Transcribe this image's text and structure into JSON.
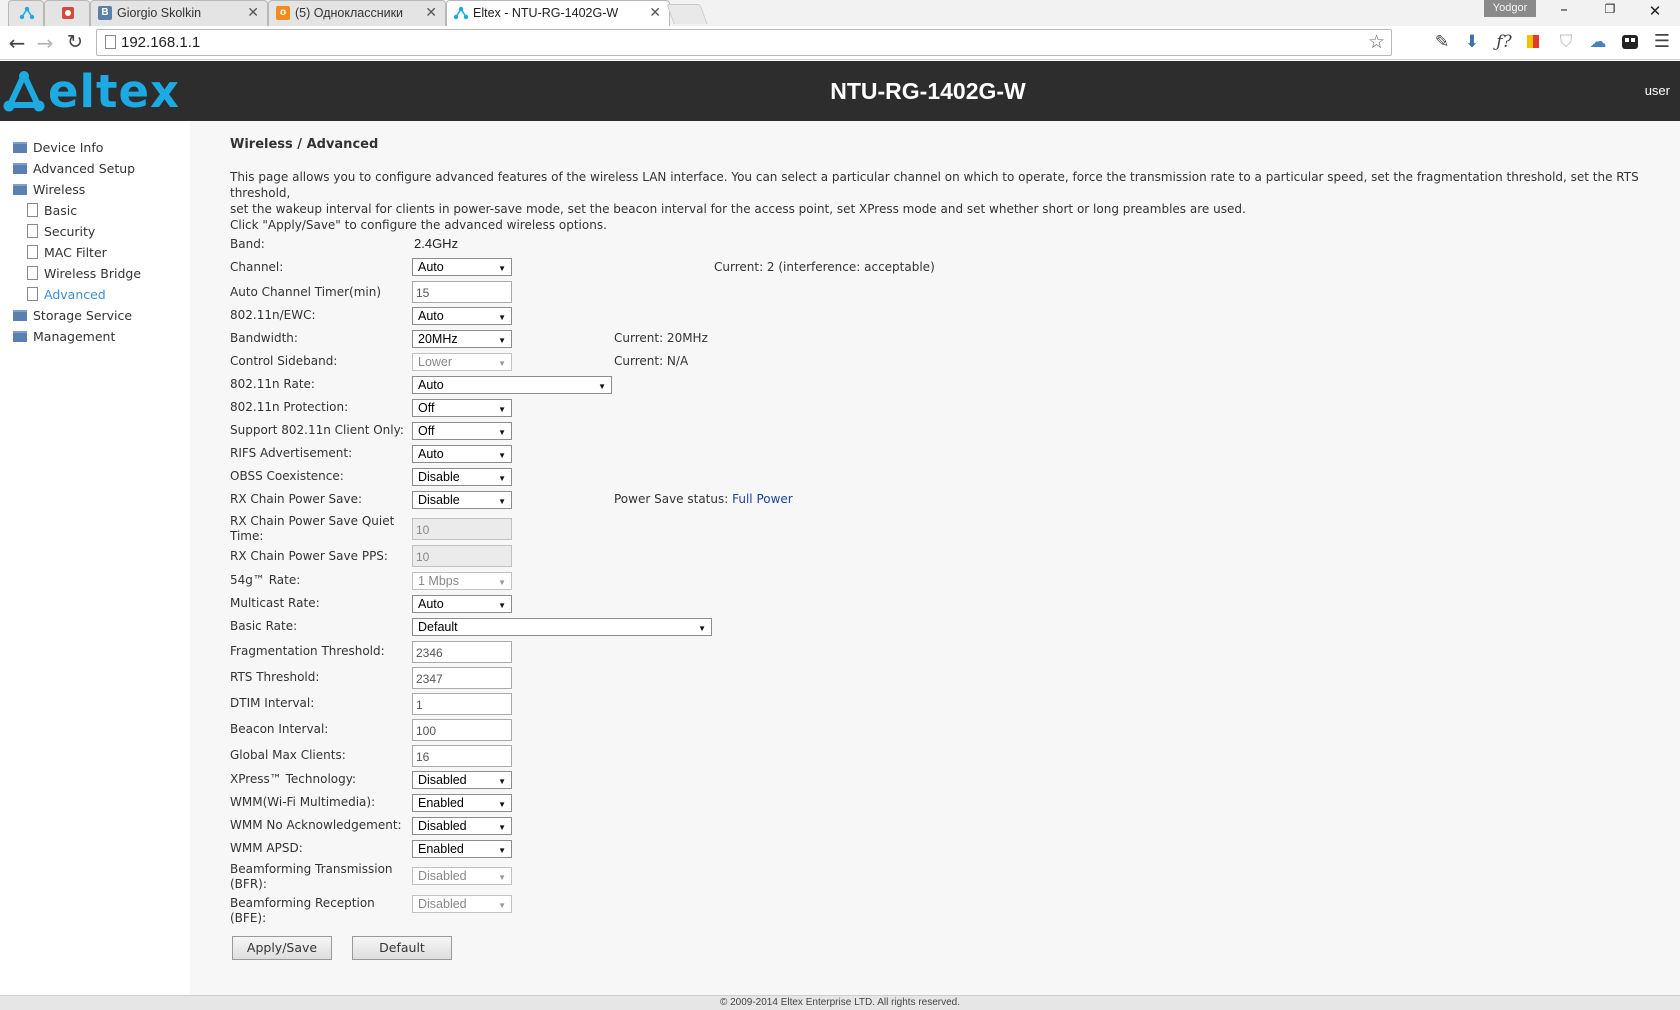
{
  "browser": {
    "tabs": [
      {
        "title": "Giorgio Skolkin",
        "icon": "vk-icon",
        "color": "#5b7fa6"
      },
      {
        "title": "(5) Одноклассники",
        "icon": "ok-icon",
        "color": "#f28a1e"
      },
      {
        "title": "Eltex - NTU-RG-1402G-W",
        "icon": "eltex-icon",
        "color": "#1da9e1"
      }
    ],
    "profile": "Yodgor",
    "url": "192.168.1.1",
    "tab_close_glyph": "✕"
  },
  "header": {
    "logo_text": "eltex",
    "model": "NTU-RG-1402G-W",
    "user": "user"
  },
  "sidebar": {
    "items": [
      {
        "label": "Device Info",
        "type": "folder"
      },
      {
        "label": "Advanced Setup",
        "type": "folder"
      },
      {
        "label": "Wireless",
        "type": "folder"
      },
      {
        "label": "Basic",
        "type": "page"
      },
      {
        "label": "Security",
        "type": "page"
      },
      {
        "label": "MAC Filter",
        "type": "page"
      },
      {
        "label": "Wireless Bridge",
        "type": "page"
      },
      {
        "label": "Advanced",
        "type": "page",
        "active": true
      },
      {
        "label": "Storage Service",
        "type": "folder"
      },
      {
        "label": "Management",
        "type": "folder"
      }
    ]
  },
  "page": {
    "heading": "Wireless / Advanced",
    "desc1": "This page allows you to configure advanced features of the wireless LAN interface. You can select a particular channel on which to operate, force the transmission rate to a particular speed, set the fragmentation threshold, set the RTS threshold,",
    "desc2": "set the wakeup interval for clients in power-save mode, set the beacon interval for the access point, set XPress mode and set whether short or long preambles are used.",
    "desc3": "Click \"Apply/Save\" to configure the advanced wireless options."
  },
  "fields": {
    "band": {
      "label": "Band:",
      "value": "2.4GHz"
    },
    "channel": {
      "label": "Channel:",
      "value": "Auto",
      "note": "Current: 2 (interference: acceptable)"
    },
    "auto_channel_timer": {
      "label": "Auto Channel Timer(min)",
      "value": "15"
    },
    "ewc": {
      "label": "802.11n/EWC:",
      "value": "Auto"
    },
    "bandwidth": {
      "label": "Bandwidth:",
      "value": "20MHz",
      "note": "Current: 20MHz"
    },
    "control_sideband": {
      "label": "Control Sideband:",
      "value": "Lower",
      "note": "Current: N/A"
    },
    "n_rate": {
      "label": "802.11n Rate:",
      "value": "Auto"
    },
    "n_protection": {
      "label": "802.11n Protection:",
      "value": "Off"
    },
    "n_client_only": {
      "label": "Support 802.11n Client Only:",
      "value": "Off"
    },
    "rifs": {
      "label": "RIFS Advertisement:",
      "value": "Auto"
    },
    "obss": {
      "label": "OBSS Coexistence:",
      "value": "Disable"
    },
    "rx_power_save": {
      "label": "RX Chain Power Save:",
      "value": "Disable",
      "note_label": "Power Save status:",
      "note_value": "Full Power"
    },
    "rx_quiet_time": {
      "label": "RX Chain Power Save Quiet Time:",
      "value": "10"
    },
    "rx_pps": {
      "label": "RX Chain Power Save PPS:",
      "value": "10"
    },
    "g_rate": {
      "label": "54g™ Rate:",
      "value": "1 Mbps"
    },
    "multicast_rate": {
      "label": "Multicast Rate:",
      "value": "Auto"
    },
    "basic_rate": {
      "label": "Basic Rate:",
      "value": "Default"
    },
    "frag_threshold": {
      "label": "Fragmentation Threshold:",
      "value": "2346"
    },
    "rts_threshold": {
      "label": "RTS Threshold:",
      "value": "2347"
    },
    "dtim": {
      "label": "DTIM Interval:",
      "value": "1"
    },
    "beacon": {
      "label": "Beacon Interval:",
      "value": "100"
    },
    "max_clients": {
      "label": "Global Max Clients:",
      "value": "16"
    },
    "xpress": {
      "label": "XPress™ Technology:",
      "value": "Disabled"
    },
    "wmm": {
      "label": "WMM(Wi-Fi Multimedia):",
      "value": "Enabled"
    },
    "wmm_noack": {
      "label": "WMM No Acknowledgement:",
      "value": "Disabled"
    },
    "wmm_apsd": {
      "label": "WMM APSD:",
      "value": "Enabled"
    },
    "bfr": {
      "label": "Beamforming Transmission (BFR):",
      "value": "Disabled"
    },
    "bfe": {
      "label": "Beamforming Reception (BFE):",
      "value": "Disabled"
    }
  },
  "buttons": {
    "apply": "Apply/Save",
    "default": "Default"
  },
  "footer": "© 2009-2014 Eltex Enterprise LTD. All rights reserved.",
  "colors": {
    "brand": "#1da9e1",
    "header_bg": "#2d2d2d",
    "active_nav": "#3a8fd8"
  }
}
